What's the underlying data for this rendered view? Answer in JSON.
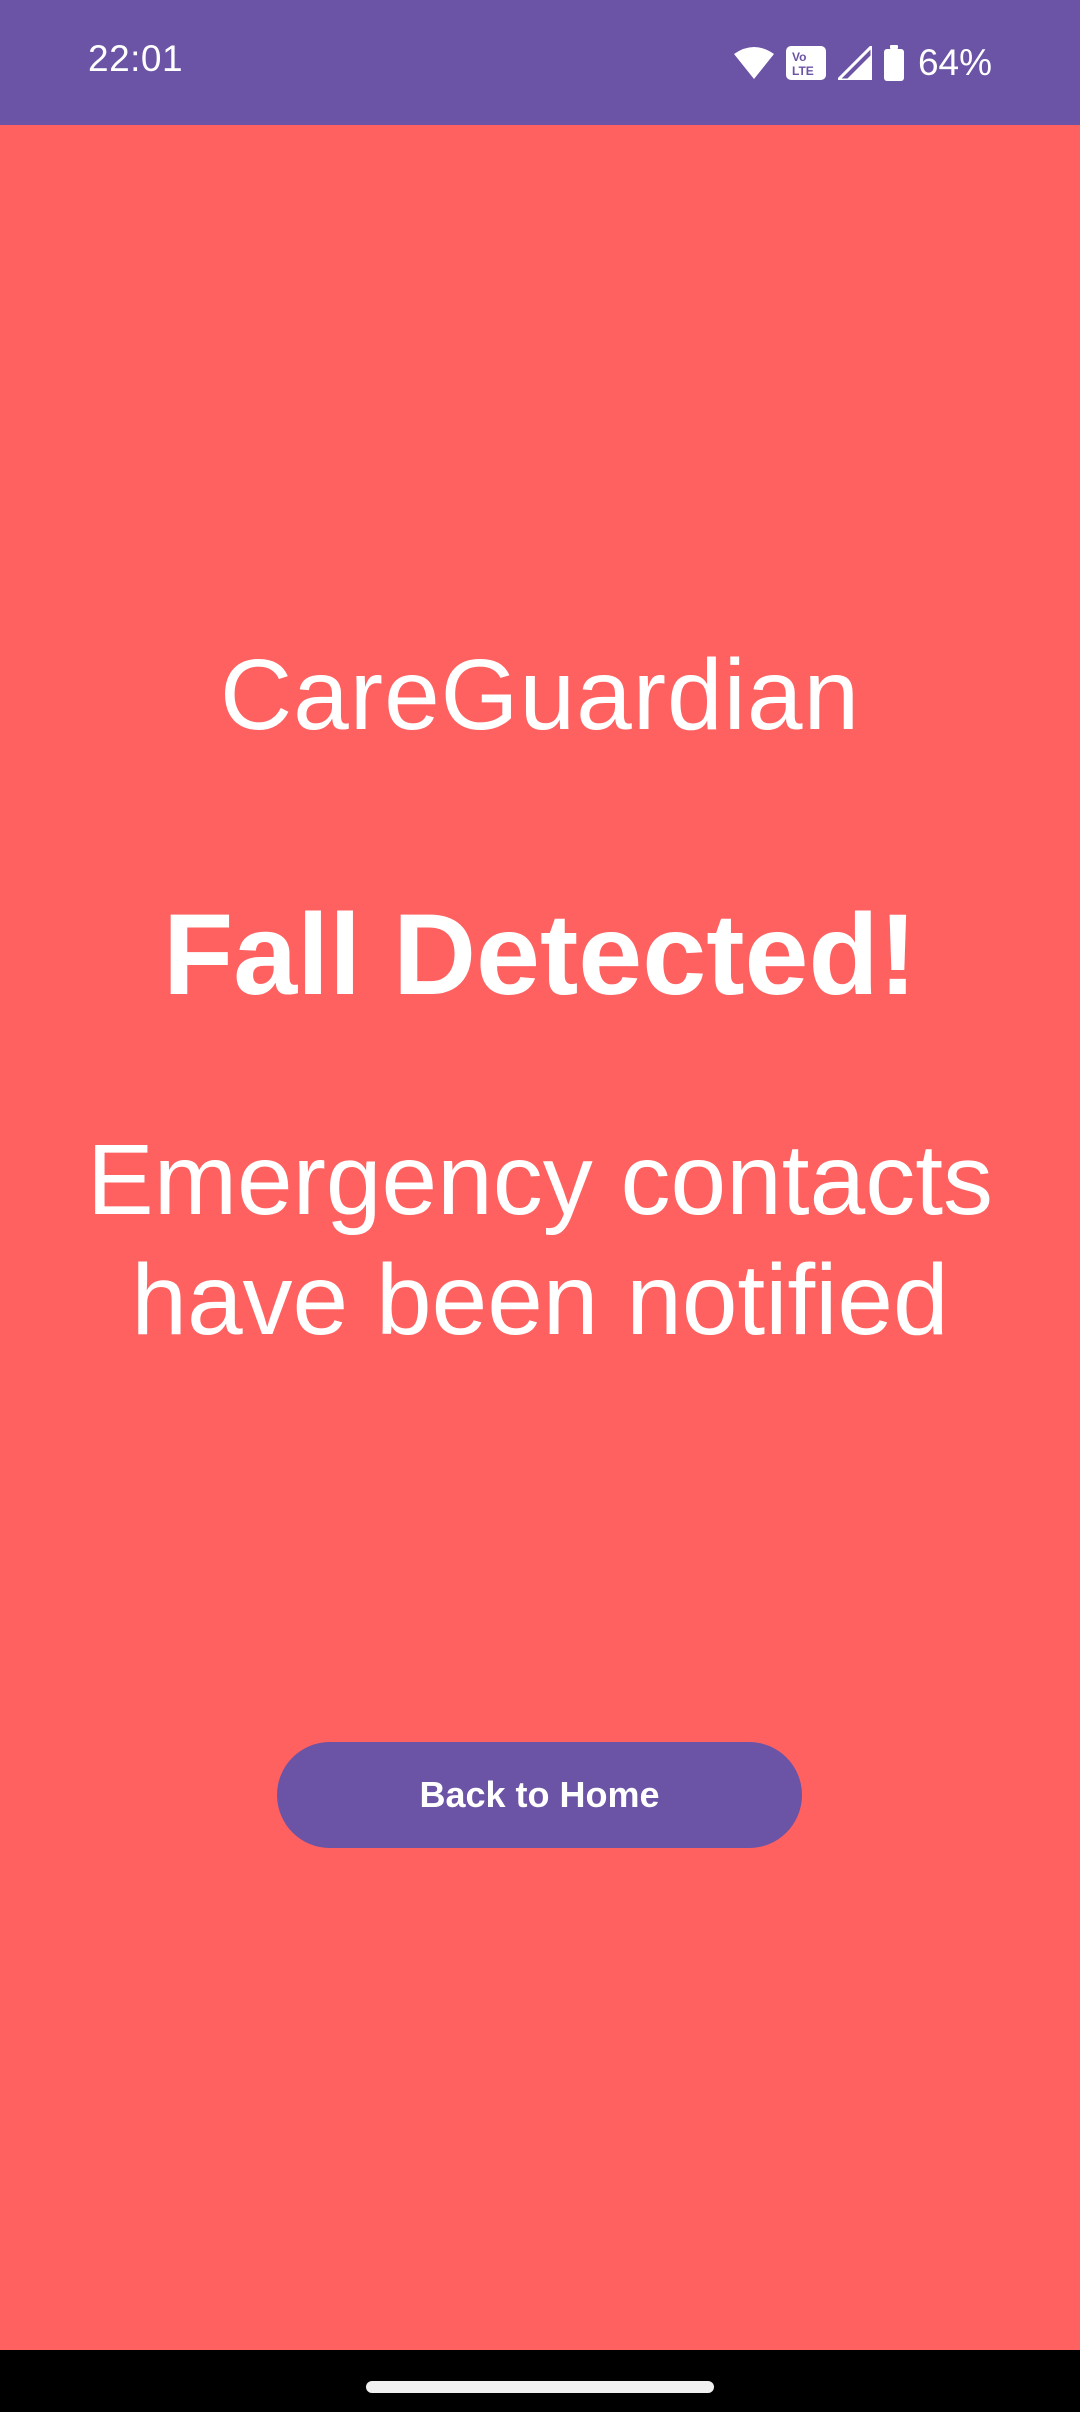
{
  "status_bar": {
    "time": "22:01",
    "battery_percent": "64%",
    "volte_label": "Vo LTE",
    "icons": [
      "wifi-icon",
      "volte-icon",
      "signal-icon",
      "battery-icon"
    ],
    "background_color": "#6b53a5"
  },
  "screen": {
    "background_color": "#ff6161",
    "app_name": "CareGuardian",
    "alert_title": "Fall Detected!",
    "alert_message": "Emergency contacts have been notified"
  },
  "actions": {
    "home_button_label": "Back to Home",
    "button_color": "#6b53a5"
  }
}
